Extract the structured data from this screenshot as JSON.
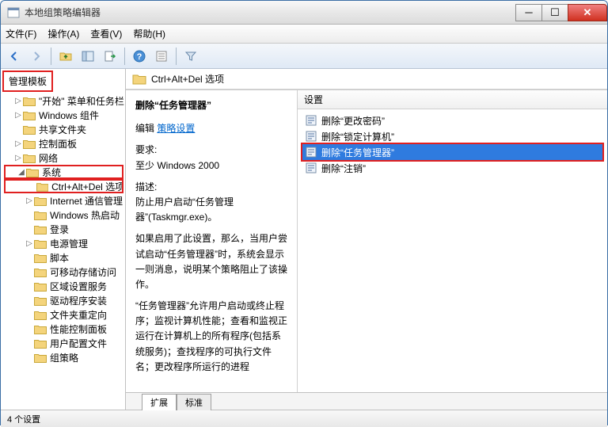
{
  "window": {
    "title": "本地组策略编辑器"
  },
  "menu": {
    "file": "文件(F)",
    "action": "操作(A)",
    "view": "查看(V)",
    "help": "帮助(H)"
  },
  "tree": {
    "root": "管理模板",
    "items": [
      {
        "label": "\"开始\" 菜单和任务栏",
        "indent": 1,
        "exp": "▷"
      },
      {
        "label": "Windows 组件",
        "indent": 1,
        "exp": "▷"
      },
      {
        "label": "共享文件夹",
        "indent": 1,
        "exp": ""
      },
      {
        "label": "控制面板",
        "indent": 1,
        "exp": "▷"
      },
      {
        "label": "网络",
        "indent": 1,
        "exp": "▷"
      },
      {
        "label": "系统",
        "indent": 1,
        "exp": "◢",
        "hl": true
      },
      {
        "label": "Ctrl+Alt+Del 选项",
        "indent": 2,
        "exp": "",
        "hl": true
      },
      {
        "label": "Internet 通信管理",
        "indent": 2,
        "exp": "▷"
      },
      {
        "label": "Windows 热启动",
        "indent": 2,
        "exp": ""
      },
      {
        "label": "登录",
        "indent": 2,
        "exp": ""
      },
      {
        "label": "电源管理",
        "indent": 2,
        "exp": "▷"
      },
      {
        "label": "脚本",
        "indent": 2,
        "exp": ""
      },
      {
        "label": "可移动存储访问",
        "indent": 2,
        "exp": ""
      },
      {
        "label": "区域设置服务",
        "indent": 2,
        "exp": ""
      },
      {
        "label": "驱动程序安装",
        "indent": 2,
        "exp": ""
      },
      {
        "label": "文件夹重定向",
        "indent": 2,
        "exp": ""
      },
      {
        "label": "性能控制面板",
        "indent": 2,
        "exp": ""
      },
      {
        "label": "用户配置文件",
        "indent": 2,
        "exp": ""
      },
      {
        "label": "组策略",
        "indent": 2,
        "exp": ""
      }
    ]
  },
  "address": {
    "path": "Ctrl+Alt+Del 选项"
  },
  "desc": {
    "heading": "删除“任务管理器”",
    "edit_prefix": "编辑",
    "edit_link": "策略设置",
    "req_label": "要求:",
    "req_value": "至少 Windows 2000",
    "desc_label": "描述:",
    "desc_p1": "防止用户启动“任务管理器”(Taskmgr.exe)。",
    "desc_p2": "如果启用了此设置，那么，当用户尝试启动“任务管理器”时，系统会显示一则消息，说明某个策略阻止了该操作。",
    "desc_p3": "“任务管理器”允许用户启动或终止程序；监视计算机性能；查看和监视正运行在计算机上的所有程序(包括系统服务)；查找程序的可执行文件名；更改程序所运行的进程"
  },
  "list": {
    "header": "设置",
    "rows": [
      {
        "label": "删除“更改密码”",
        "sel": false
      },
      {
        "label": "删除“锁定计算机”",
        "sel": false
      },
      {
        "label": "删除“任务管理器”",
        "sel": true
      },
      {
        "label": "删除“注销”",
        "sel": false
      }
    ]
  },
  "tabs": {
    "extended": "扩展",
    "standard": "标准"
  },
  "status": {
    "count": "4 个设置"
  }
}
